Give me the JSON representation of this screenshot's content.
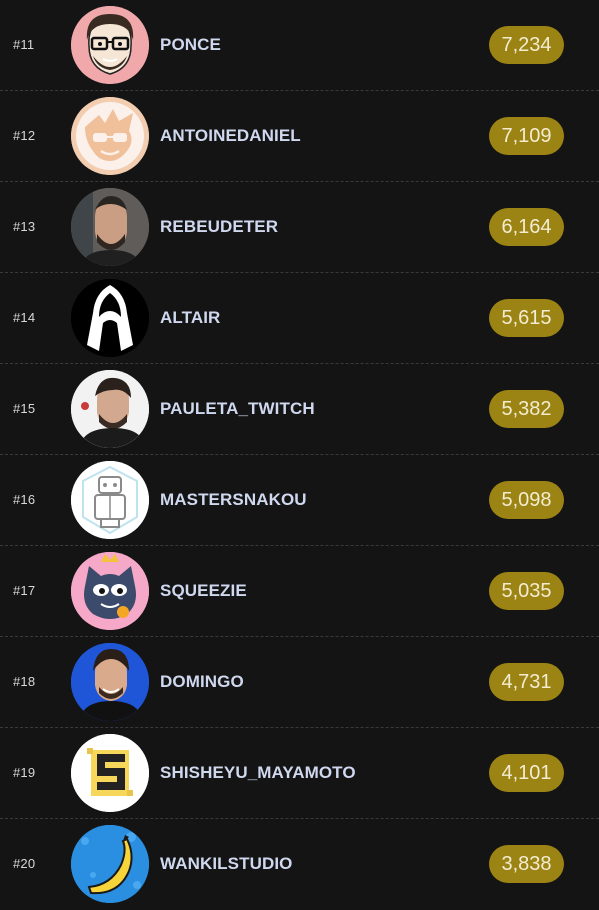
{
  "leaderboard": {
    "entries": [
      {
        "rank": "#11",
        "name": "PONCE",
        "score": "7,234",
        "avatar": "bearded-glasses-cartoon-avatar"
      },
      {
        "rank": "#12",
        "name": "ANTOINEDANIEL",
        "score": "7,109",
        "avatar": "peach-cartoon-avatar"
      },
      {
        "rank": "#13",
        "name": "REBEUDETER",
        "score": "6,164",
        "avatar": "photo-avatar"
      },
      {
        "rank": "#14",
        "name": "ALTAIR",
        "score": "5,615",
        "avatar": "hooded-assassin-avatar"
      },
      {
        "rank": "#15",
        "name": "PAULETA_TWITCH",
        "score": "5,382",
        "avatar": "photo-avatar"
      },
      {
        "rank": "#16",
        "name": "MASTERSNAKOU",
        "score": "5,098",
        "avatar": "robot-line-art-avatar"
      },
      {
        "rank": "#17",
        "name": "SQUEEZIE",
        "score": "5,035",
        "avatar": "crowned-cat-avatar"
      },
      {
        "rank": "#18",
        "name": "DOMINGO",
        "score": "4,731",
        "avatar": "photo-avatar"
      },
      {
        "rank": "#19",
        "name": "SHISHEYU_MAYAMOTO",
        "score": "4,101",
        "avatar": "pixel-s-logo-avatar"
      },
      {
        "rank": "#20",
        "name": "WANKILSTUDIO",
        "score": "3,838",
        "avatar": "banana-avatar"
      }
    ]
  },
  "colors": {
    "background": "#141414",
    "score_pill": "#9b8414",
    "name_text": "#cfd8ef",
    "rank_text": "#d8d8d8"
  }
}
